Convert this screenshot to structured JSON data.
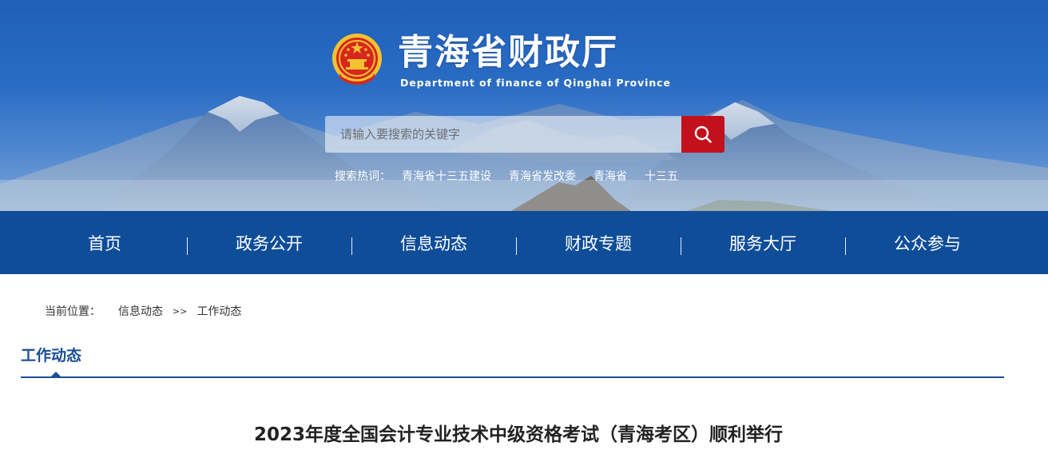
{
  "header": {
    "title": "青海省财政厅",
    "subtitle": "Department of finance of Qinghai Province",
    "emblem_icon": "national-emblem-icon"
  },
  "search": {
    "placeholder": "请输入要搜索的关键字",
    "button_icon": "search-icon",
    "hot_label": "搜索热词：",
    "hot_words": [
      "青海省十三五建设",
      "青海省发改委",
      "青海省",
      "十三五"
    ]
  },
  "nav": {
    "items": [
      "首页",
      "政务公开",
      "信息动态",
      "财政专题",
      "服务大厅",
      "公众参与"
    ]
  },
  "breadcrumb": {
    "label": "当前位置：",
    "items": [
      "信息动态",
      "工作动态"
    ],
    "separator": ">>"
  },
  "section": {
    "title": "工作动态"
  },
  "article": {
    "title": "2023年度全国会计专业技术中级资格考试（青海考区）顺利举行"
  },
  "colors": {
    "nav_bg": "#0f4d98",
    "search_button": "#c3111b",
    "section_accent": "#1a4f95"
  }
}
